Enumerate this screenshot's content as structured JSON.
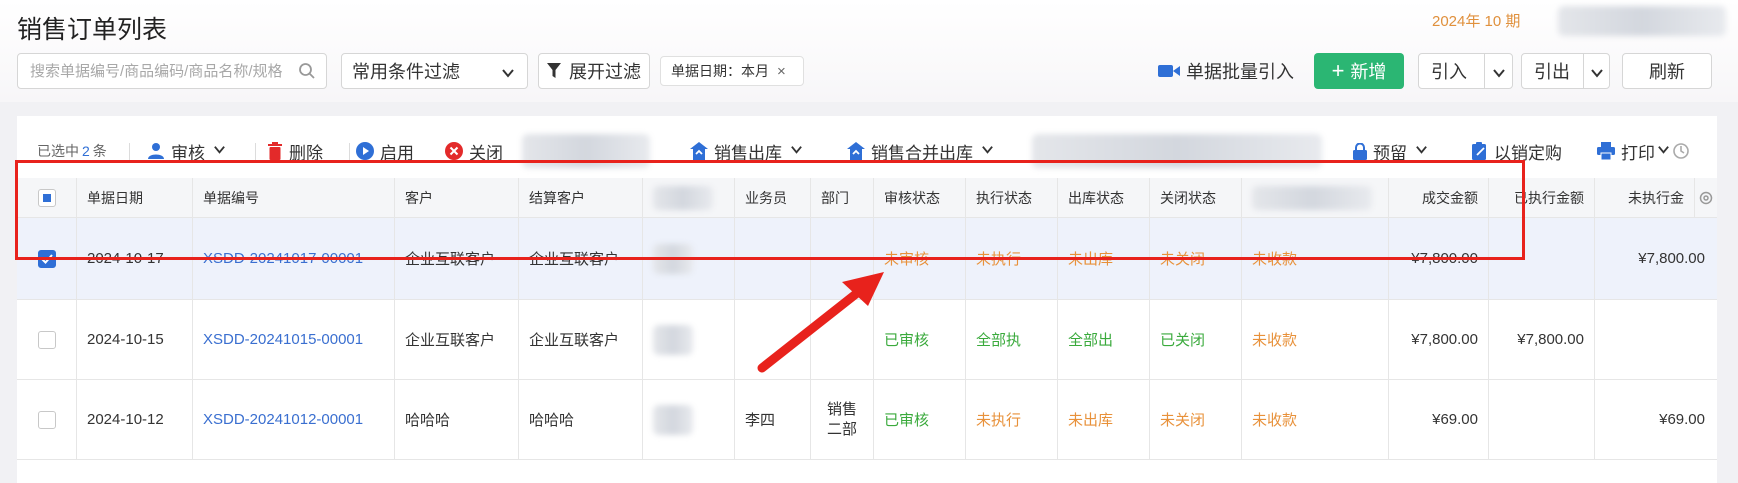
{
  "header": {
    "title": "销售订单列表",
    "period": "2024年 10 期"
  },
  "filters": {
    "search_placeholder": "搜索单据编号/商品编码/商品名称/规格",
    "condition_select": "常用条件过滤",
    "expand_filter": "展开过滤",
    "date_tag": "单据日期：本月",
    "batch_import": "单据批量引入",
    "add_button": "新增",
    "import_button": "引入",
    "export_button": "引出",
    "refresh_button": "刷新"
  },
  "toolbar": {
    "selected_prefix": "已选中",
    "selected_count": "2",
    "selected_suffix": "条",
    "audit": "审核",
    "delete": "删除",
    "enable": "启用",
    "close": "关闭",
    "sales_out": "销售出库",
    "merged_out": "销售合并出库",
    "reserve": "预留",
    "purchase_by_sale": "以销定购",
    "print": "打印"
  },
  "table": {
    "columns": [
      "单据日期",
      "单据编号",
      "客户",
      "结算客户",
      "业务员",
      "部门",
      "审核状态",
      "执行状态",
      "出库状态",
      "关闭状态",
      "成交金额",
      "已执行金额",
      "未执行金"
    ],
    "rows": [
      {
        "checked": true,
        "date": "2024-10-17",
        "no": "XSDD-20241017-00001",
        "customer": "企业互联客户",
        "settle": "企业互联客户",
        "salesman": "",
        "dept": "",
        "audit": "未审核",
        "exec": "未执行",
        "out": "未出库",
        "closed": "未关闭",
        "collect": "未收款",
        "amount": "¥7,800.00",
        "executed": "",
        "unexecuted": "¥7,800.00"
      },
      {
        "checked": false,
        "date": "2024-10-15",
        "no": "XSDD-20241015-00001",
        "customer": "企业互联客户",
        "settle": "企业互联客户",
        "salesman": "",
        "dept": "",
        "audit": "已审核",
        "exec": "全部执",
        "out": "全部出",
        "closed": "已关闭",
        "collect": "未收款",
        "amount": "¥7,800.00",
        "executed": "¥7,800.00",
        "unexecuted": ""
      },
      {
        "checked": false,
        "date": "2024-10-12",
        "no": "XSDD-20241012-00001",
        "customer": "哈哈哈",
        "settle": "哈哈哈",
        "salesman": "李四",
        "dept": "销售二部",
        "audit": "已审核",
        "exec": "未执行",
        "out": "未出库",
        "closed": "未关闭",
        "collect": "未收款",
        "amount": "¥69.00",
        "executed": "",
        "unexecuted": "¥69.00"
      }
    ]
  },
  "colors": {
    "accent": "#2f6fd6",
    "primary_button": "#2bb673",
    "pending": "#e8913a",
    "done": "#3aaa3c",
    "highlight": "#e8221c"
  }
}
